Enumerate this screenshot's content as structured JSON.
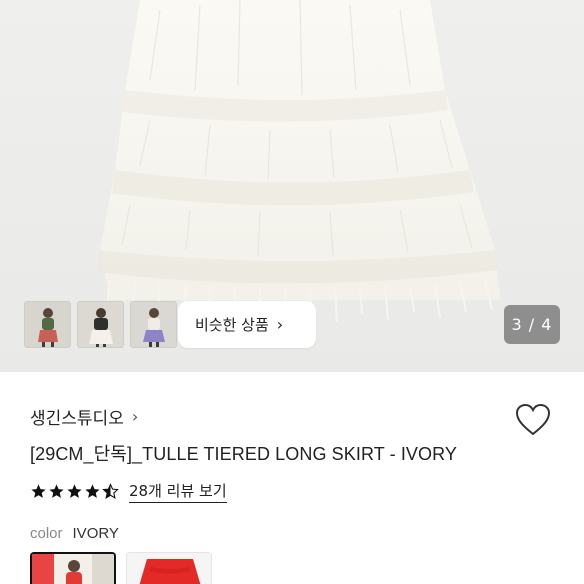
{
  "gallery": {
    "thumbnails": [
      {
        "icon": "model-photo-1-thumbnail"
      },
      {
        "icon": "model-photo-2-thumbnail"
      },
      {
        "icon": "model-photo-3-thumbnail"
      }
    ],
    "similar_button_label": "비슷한 상품",
    "counter": "3 / 4"
  },
  "product": {
    "brand": "생긴스튜디오",
    "title": "[29CM_단독]_TULLE TIERED LONG SKIRT - IVORY",
    "rating": 4.5,
    "review_link": "28개 리뷰 보기",
    "color_label": "color",
    "color_value": "IVORY",
    "swatches": [
      {
        "name": "IVORY",
        "selected": true
      },
      {
        "name": "RED",
        "selected": false
      }
    ]
  },
  "colors": {
    "counter_bg": "#8e8e8e",
    "hero_bg": "#ececea",
    "skirt": "#faf8f1",
    "red_swatch": "#e32a27"
  }
}
